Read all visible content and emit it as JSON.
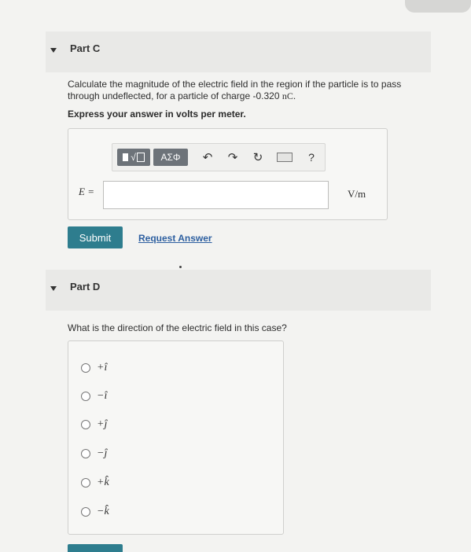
{
  "part_c": {
    "title": "Part C",
    "question_line1": "Calculate the magnitude of the electric field in the region if the particle is to pass",
    "question_line2_prefix": "through undeflected, for a particle of charge -0.320 ",
    "question_line2_unit": "nC",
    "question_line2_suffix": ".",
    "instruction": "Express your answer in volts per meter.",
    "toolbar": {
      "templates_label": "√",
      "greek_label": "ΑΣΦ",
      "undo_icon": "undo-icon",
      "redo_icon": "redo-icon",
      "reset_icon": "reset-icon",
      "keyboard_icon": "keyboard-icon",
      "help_label": "?"
    },
    "variable_label": "E =",
    "answer_value": "",
    "unit": "V/m",
    "submit_label": "Submit",
    "request_answer_label": "Request Answer"
  },
  "part_d": {
    "title": "Part D",
    "question": "What is the direction of the electric field in this case?",
    "choices": [
      "+î",
      "−î",
      "+ĵ",
      "−ĵ",
      "+k̂",
      "−k̂"
    ]
  }
}
